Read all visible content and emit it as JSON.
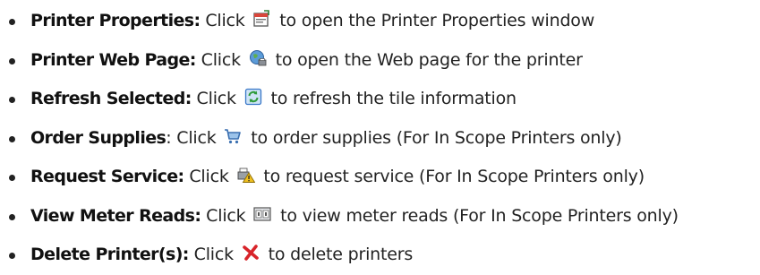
{
  "items": [
    {
      "term": "Printer Properties:",
      "pre": " Click",
      "icon": "printer-properties-icon",
      "post": " to open the Printer Properties window"
    },
    {
      "term": "Printer Web Page:",
      "pre": " Click",
      "icon": "globe-web-icon",
      "post": " to open the Web page for the printer"
    },
    {
      "term": "Refresh Selected:",
      "pre": " Click",
      "icon": "refresh-icon",
      "post": " to refresh the tile information"
    },
    {
      "term": "Order Supplies",
      "pre": ": Click",
      "icon": "shopping-cart-icon",
      "post": " to order supplies (For In Scope Printers only)"
    },
    {
      "term": "Request Service:",
      "pre": " Click",
      "icon": "service-warning-icon",
      "post": " to request service (For In Scope Printers only)"
    },
    {
      "term": "View Meter Reads:",
      "pre": " Click",
      "icon": "meter-reads-icon",
      "post": " to view meter reads (For In Scope Printers only)"
    },
    {
      "term": "Delete Printer(s):",
      "pre": " Click",
      "icon": "delete-x-icon",
      "post": " to delete printers"
    }
  ],
  "colors": {
    "text": "#222222",
    "icon_blue": "#3a78c8",
    "icon_green": "#2e9b3a",
    "icon_red": "#d8242a",
    "icon_yellow": "#f0c020"
  }
}
